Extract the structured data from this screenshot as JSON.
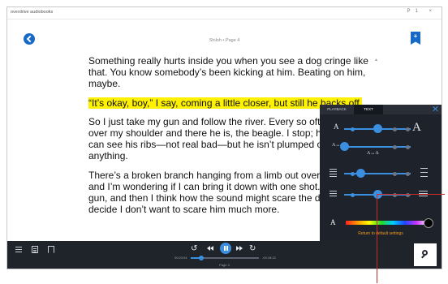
{
  "window": {
    "title": "overdrive audiobooks",
    "controls": "P1 ×"
  },
  "header": {
    "chapter": "Shiloh • Page 4",
    "bookmark_icon": "+"
  },
  "book": {
    "paragraphs": [
      {
        "text": "Something really hurts inside you when you see a dog cringe like that. You know somebody’s been kicking at him. Beating on him, maybe.",
        "highlight": false
      },
      {
        "text": "“It’s okay, boy,” I say, coming a little closer, but still he backs off.",
        "highlight": true
      },
      {
        "text": "So I just take my gun and follow the river. Every so often I look over my shoulder and there he is, the beagle. I stop; he stops. I can see his ribs—not real bad—but he isn’t plumped out like anything.",
        "highlight": false
      },
      {
        "text": "There’s a broken branch hanging from a limb out over the water, and I’m wondering if I can bring it down with one shot. I raise my gun, and then I think how the sound might scare the dog off. I decide I don’t want to scare him much more.",
        "highlight": false
      }
    ]
  },
  "settings_panel": {
    "tabs": [
      {
        "label": "PLAYBACK",
        "active": false
      },
      {
        "label": "TEXT",
        "active": true
      }
    ],
    "font_size": {
      "small": "A",
      "large": "A",
      "value": 0.5
    },
    "letter_spacing": {
      "left": "A↔A",
      "right": "A↔A",
      "value": 0.0
    },
    "line_spacing": {
      "value": 0.25
    },
    "margins": {
      "value": 0.5
    },
    "color_label": "A",
    "reset_label": "Return to default settings"
  },
  "player": {
    "time_elapsed": "00:03:54",
    "time_remaining": "-00:18:22",
    "progress": 0.15,
    "page_label": "Page 4",
    "rewind_glyph": "↺",
    "forward_glyph": "↻"
  },
  "colors": {
    "accent": "#3a8fe0",
    "highlight": "#fff200",
    "reset_link": "#f39a1f",
    "panel_bg": "#1d222b",
    "bar_bg": "#1f232a",
    "callout": "#cc2a2a"
  }
}
